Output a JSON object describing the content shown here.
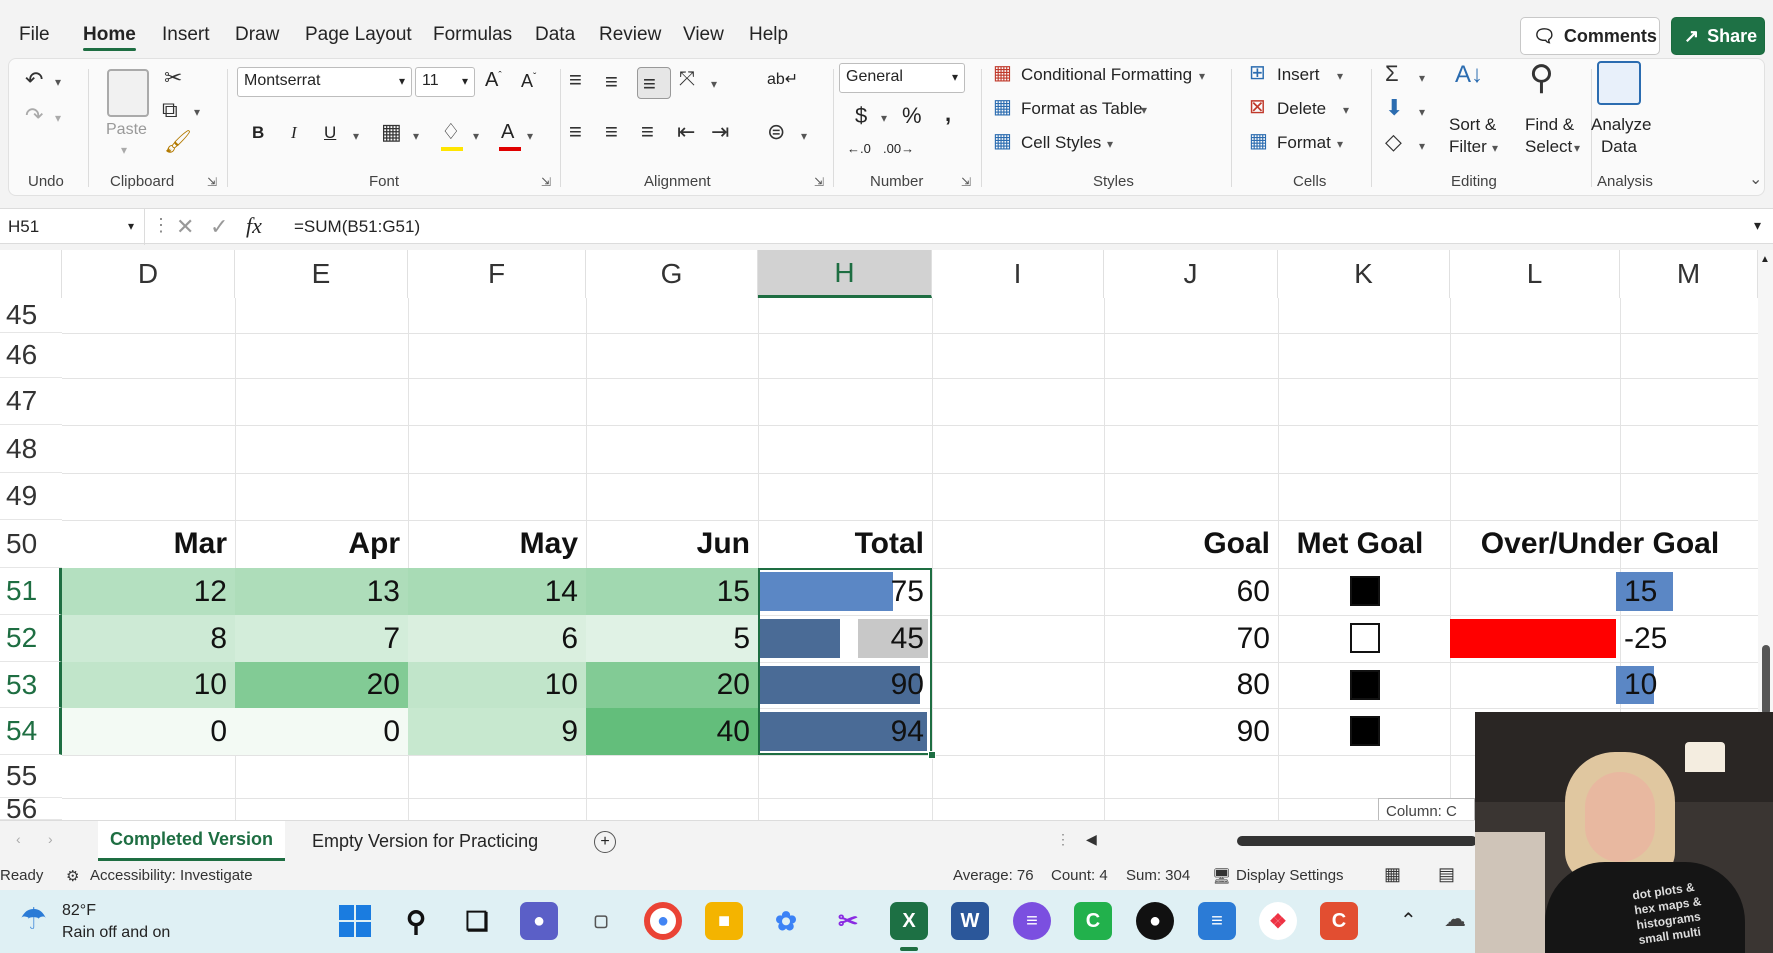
{
  "menu": {
    "items": [
      "File",
      "Home",
      "Insert",
      "Draw",
      "Page Layout",
      "Formulas",
      "Data",
      "Review",
      "View",
      "Help"
    ],
    "active": "Home",
    "comments_label": "Comments",
    "share_label": "Share"
  },
  "ribbon": {
    "groups": {
      "undo": "Undo",
      "clipboard": "Clipboard",
      "font": "Font",
      "alignment": "Alignment",
      "number": "Number",
      "styles": "Styles",
      "cells": "Cells",
      "editing": "Editing",
      "analysis": "Analysis"
    },
    "paste_label": "Paste",
    "font_name": "Montserrat",
    "font_size": "11",
    "number_format": "General",
    "conditional_formatting": "Conditional Formatting",
    "format_as_table": "Format as Table",
    "cell_styles": "Cell Styles",
    "insert": "Insert",
    "delete": "Delete",
    "format": "Format",
    "sort_filter": [
      "Sort &",
      "Filter"
    ],
    "find_select": [
      "Find &",
      "Select"
    ],
    "analyze_data": [
      "Analyze",
      "Data"
    ]
  },
  "formula_bar": {
    "name_box": "H51",
    "formula": "=SUM(B51:G51)"
  },
  "sheet": {
    "columns": [
      "D",
      "E",
      "F",
      "G",
      "H",
      "I",
      "J",
      "K",
      "L",
      "M"
    ],
    "selected_column": "H",
    "rows": [
      "45",
      "46",
      "47",
      "48",
      "49",
      "50",
      "51",
      "52",
      "53",
      "54",
      "55",
      "56"
    ],
    "headers": {
      "D": "Mar",
      "E": "Apr",
      "F": "May",
      "G": "Jun",
      "H": "Total",
      "J": "Goal",
      "K": "Met Goal",
      "L": "Over/Under Goal"
    },
    "data": [
      {
        "row": "51",
        "D": "12",
        "E": "13",
        "F": "14",
        "G": "15",
        "H": "75",
        "J": "60",
        "met": true,
        "L": "15"
      },
      {
        "row": "52",
        "D": "8",
        "E": "7",
        "F": "6",
        "G": "5",
        "H": "45",
        "J": "70",
        "met": false,
        "L": "-25"
      },
      {
        "row": "53",
        "D": "10",
        "E": "20",
        "F": "10",
        "G": "20",
        "H": "90",
        "J": "80",
        "met": true,
        "L": "10"
      },
      {
        "row": "54",
        "D": "0",
        "E": "0",
        "F": "9",
        "G": "40",
        "H": "94",
        "J": "90",
        "met": true,
        "L": ""
      }
    ],
    "tooltip": "Column: C"
  },
  "tabs": {
    "items": [
      "Completed Version",
      "Empty Version for Practicing"
    ],
    "active": "Completed Version"
  },
  "status": {
    "ready": "Ready",
    "accessibility": "Accessibility: Investigate",
    "average": "Average: 76",
    "count": "Count: 4",
    "sum": "Sum: 304",
    "display_settings": "Display Settings"
  },
  "taskbar": {
    "temperature": "82°F",
    "weather": "Rain off and on"
  },
  "webcam": {
    "shirt_text": [
      "dot plots &",
      "hex maps &",
      "histograms",
      "small multi"
    ]
  },
  "colors": {
    "accent": "#1e6e42",
    "databar_light": "#5b87c5",
    "databar_dark": "#4a6b96",
    "negative_bar": "#ff0000"
  }
}
